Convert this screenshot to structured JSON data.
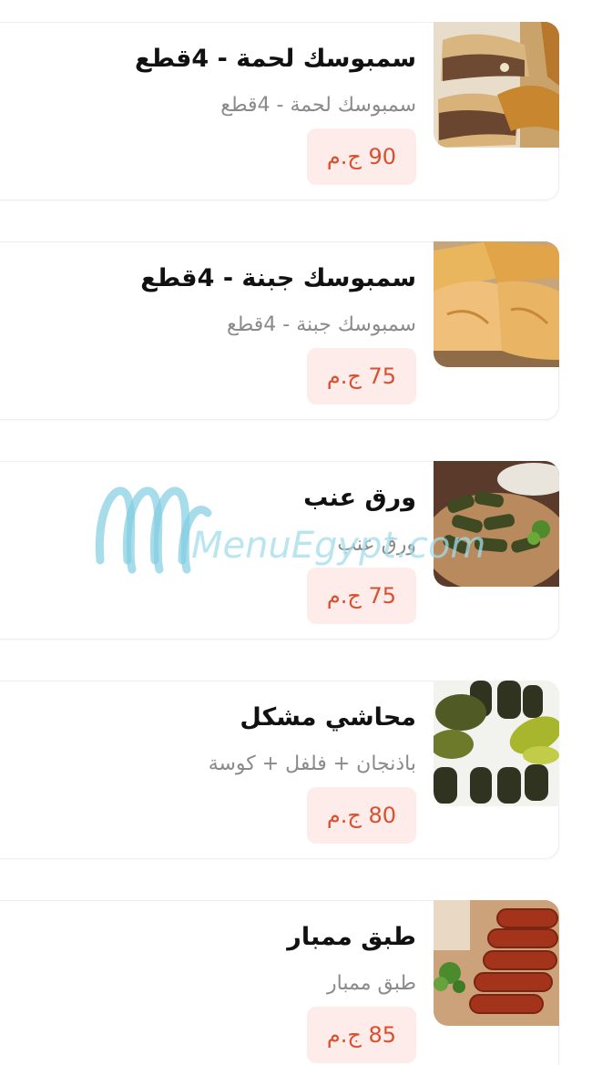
{
  "menu_items": [
    {
      "name": "سمبوسك لحمة - 4قطع",
      "description": "سمبوسك لحمة - 4قطع",
      "price": "90 ج.م",
      "image": "meat-sambousek-photo"
    },
    {
      "name": "سمبوسك جبنة - 4قطع",
      "description": "سمبوسك جبنة - 4قطع",
      "price": "75 ج.م",
      "image": "cheese-sambousek-photo"
    },
    {
      "name": "ورق عنب",
      "description": "ورق عنب",
      "price": "75 ج.م",
      "image": "grape-leaves-photo"
    },
    {
      "name": "محاشي مشكل",
      "description": "باذنجان + فلفل + كوسة",
      "price": "80 ج.م",
      "image": "mixed-mahshi-photo"
    },
    {
      "name": "طبق ممبار",
      "description": "طبق ممبار",
      "price": "85 ج.م",
      "image": "mombar-plate-photo"
    }
  ],
  "watermark": {
    "text": "MenuEgypt.com"
  },
  "colors": {
    "price_text": "#d9502f",
    "price_bg": "#fdecea",
    "title": "#111111",
    "description": "#8a8a8a",
    "watermark": "#a0dceb"
  }
}
